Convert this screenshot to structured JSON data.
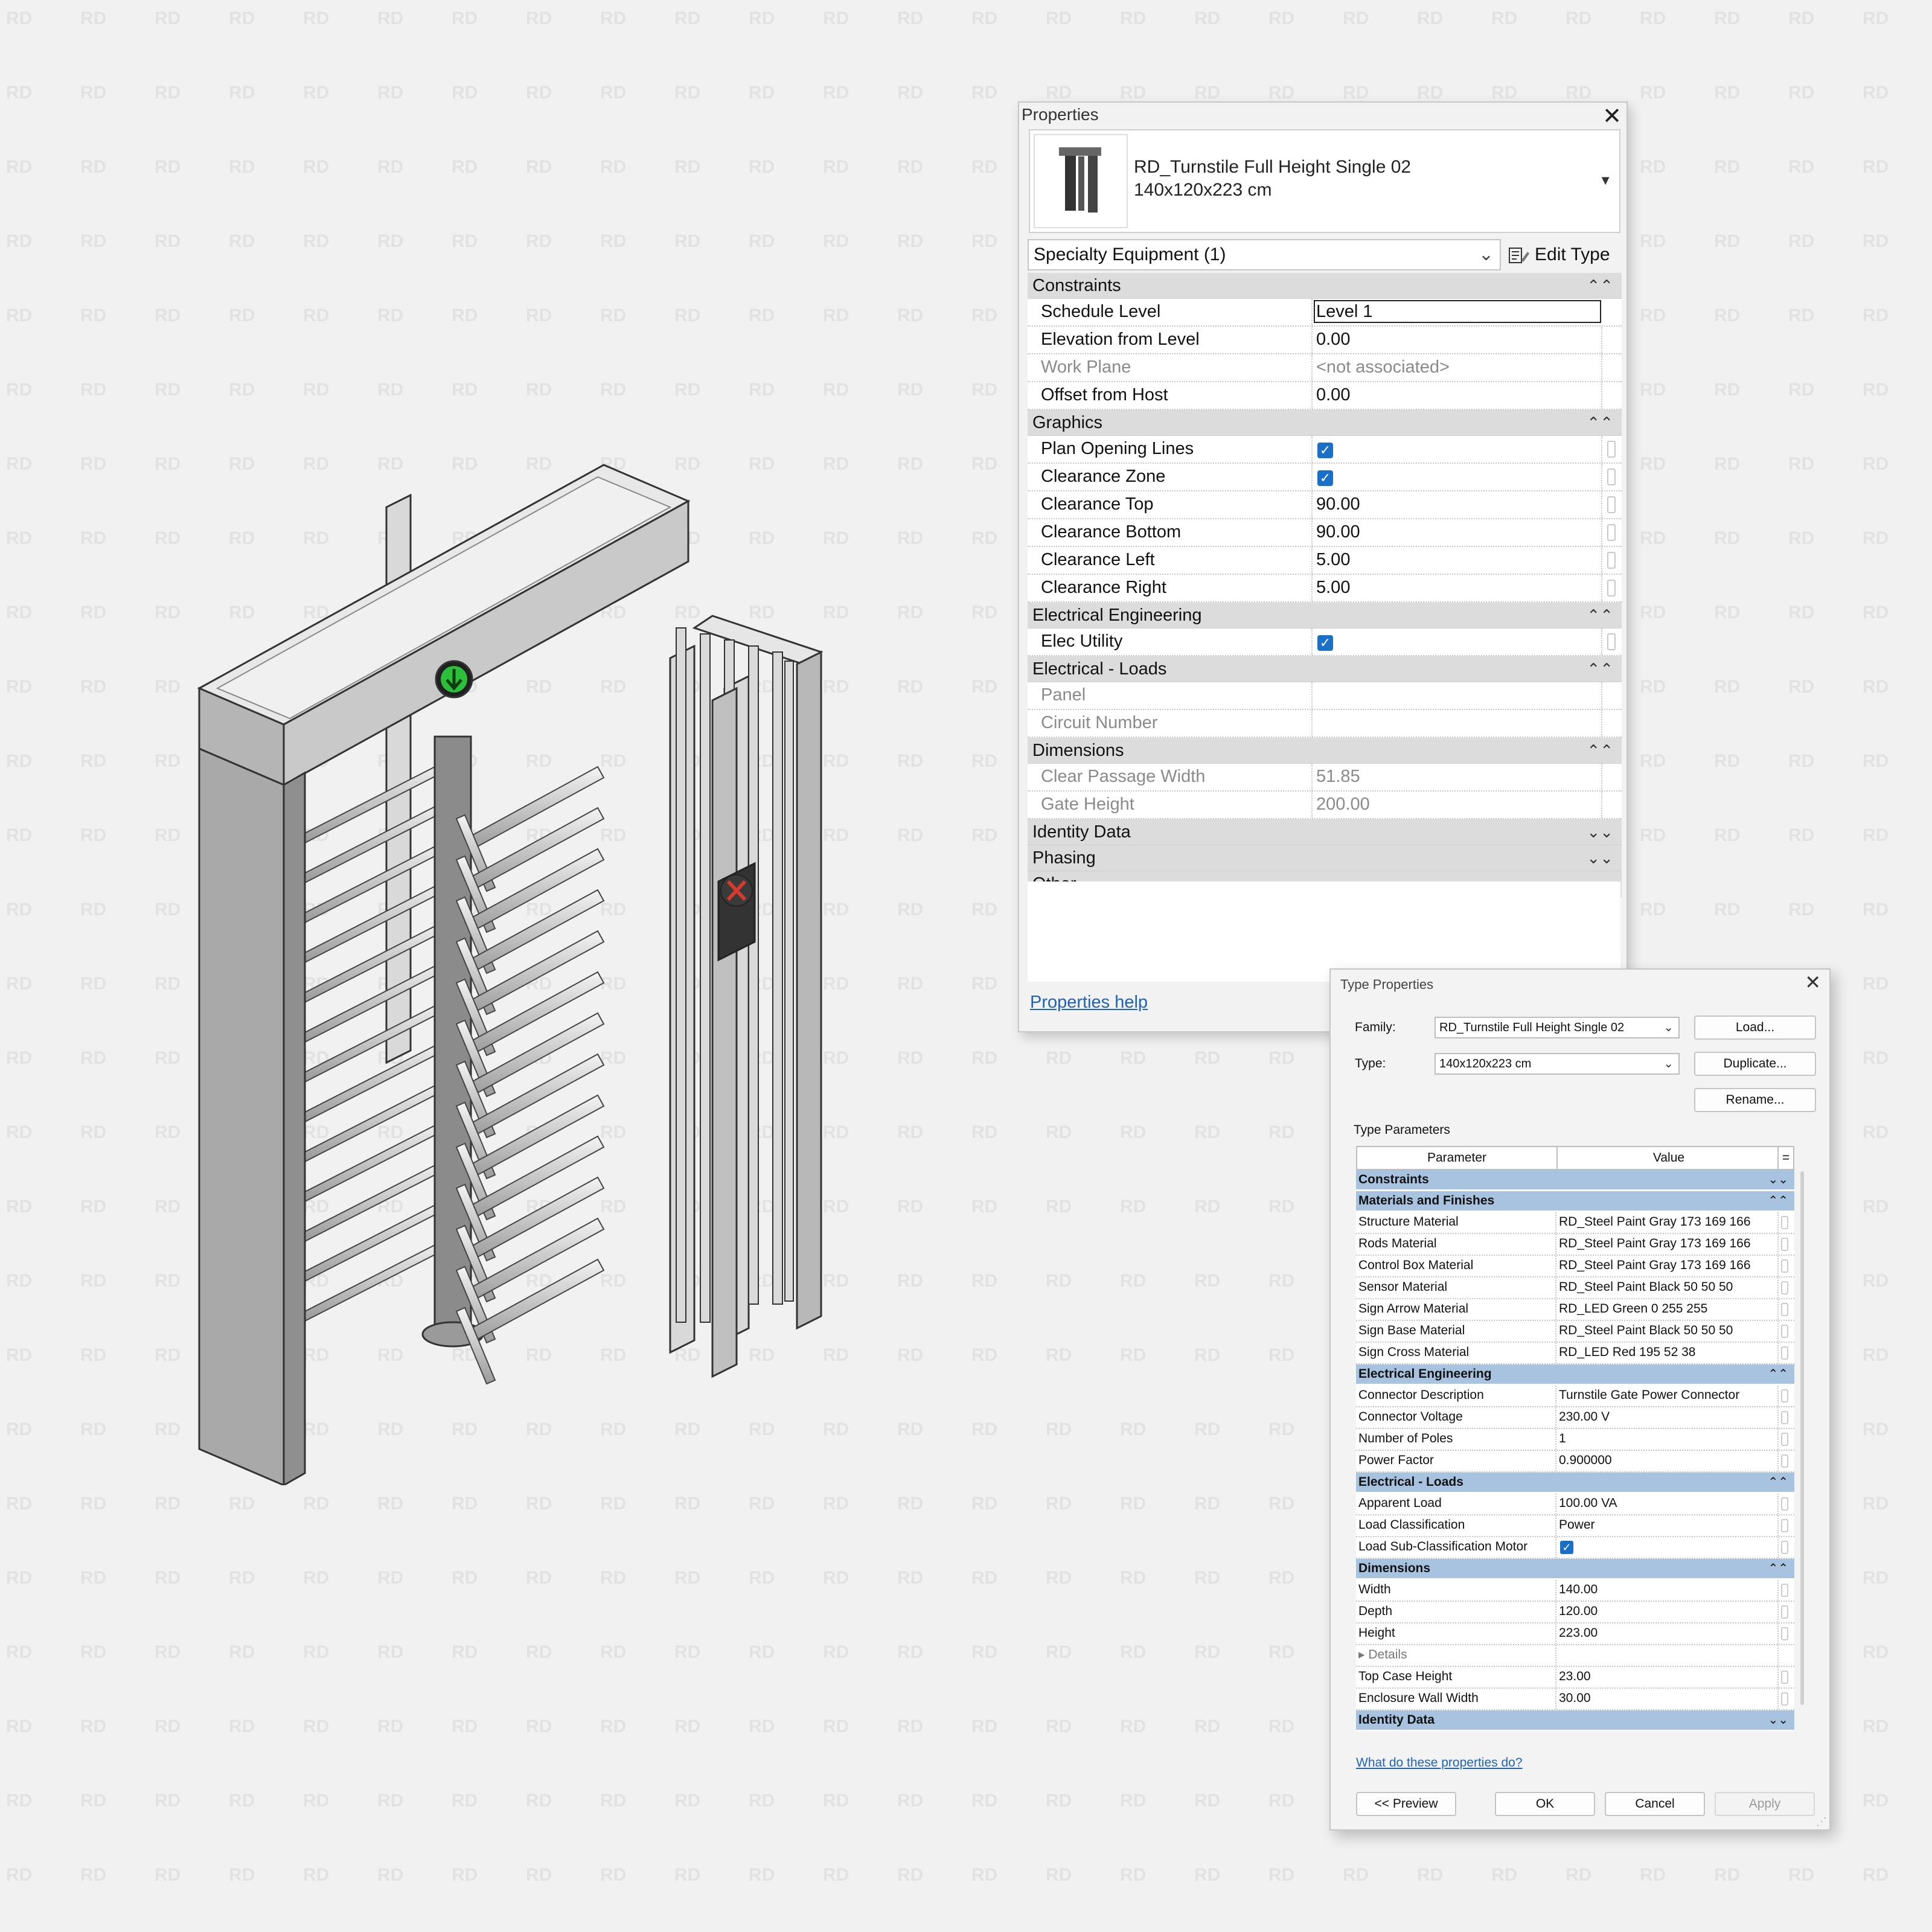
{
  "properties": {
    "title": "Properties",
    "close": "✕",
    "family_name": "RD_Turnstile Full Height Single 02",
    "type_name": "140x120x223 cm",
    "category_selector": "Specialty Equipment (1)",
    "edit_type": "Edit Type",
    "groups": {
      "constraints": "Constraints",
      "graphics": "Graphics",
      "elec_eng": "Electrical Engineering",
      "elec_loads": "Electrical - Loads",
      "dimensions": "Dimensions",
      "identity": "Identity Data",
      "phasing": "Phasing",
      "other": "Other"
    },
    "rows": {
      "schedule_level": {
        "name": "Schedule Level",
        "value": "Level 1"
      },
      "elevation": {
        "name": "Elevation from Level",
        "value": "0.00"
      },
      "work_plane": {
        "name": "Work Plane",
        "value": "<not associated>"
      },
      "offset_host": {
        "name": "Offset from Host",
        "value": "0.00"
      },
      "plan_opening": {
        "name": "Plan Opening Lines",
        "checked": true
      },
      "clearance_zone": {
        "name": "Clearance Zone",
        "checked": true
      },
      "clearance_top": {
        "name": "Clearance Top",
        "value": "90.00"
      },
      "clearance_bottom": {
        "name": "Clearance Bottom",
        "value": "90.00"
      },
      "clearance_left": {
        "name": "Clearance Left",
        "value": "5.00"
      },
      "clearance_right": {
        "name": "Clearance Right",
        "value": "5.00"
      },
      "elec_utility": {
        "name": "Elec Utility",
        "checked": true
      },
      "panel": {
        "name": "Panel",
        "value": ""
      },
      "circuit": {
        "name": "Circuit Number",
        "value": ""
      },
      "clear_passage": {
        "name": "Clear Passage Width",
        "value": "51.85"
      },
      "gate_height": {
        "name": "Gate Height",
        "value": "200.00"
      }
    },
    "help_link": "Properties help"
  },
  "type_properties": {
    "title": "Type Properties",
    "close": "✕",
    "family_label": "Family:",
    "family_value": "RD_Turnstile Full Height Single 02",
    "type_label": "Type:",
    "type_value": "140x120x223 cm",
    "load_btn": "Load...",
    "duplicate_btn": "Duplicate...",
    "rename_btn": "Rename...",
    "params_label": "Type Parameters",
    "col_param": "Parameter",
    "col_value": "Value",
    "col_eq": "=",
    "groups": {
      "constraints": "Constraints",
      "materials": "Materials and Finishes",
      "elec_eng": "Electrical Engineering",
      "elec_loads": "Electrical - Loads",
      "dimensions": "Dimensions",
      "identity": "Identity Data"
    },
    "rows": {
      "structure_material": {
        "name": "Structure Material",
        "value": "RD_Steel Paint Gray 173 169 166"
      },
      "rods_material": {
        "name": "Rods Material",
        "value": "RD_Steel Paint Gray 173 169 166"
      },
      "control_box_material": {
        "name": "Control Box Material",
        "value": "RD_Steel Paint Gray 173 169 166"
      },
      "sensor_material": {
        "name": "Sensor Material",
        "value": "RD_Steel Paint Black 50 50 50"
      },
      "sign_arrow_material": {
        "name": "Sign Arrow Material",
        "value": "RD_LED Green 0 255 255"
      },
      "sign_base_material": {
        "name": "Sign Base Material",
        "value": "RD_Steel Paint Black 50 50 50"
      },
      "sign_cross_material": {
        "name": "Sign Cross Material",
        "value": "RD_LED Red 195 52 38"
      },
      "connector_desc": {
        "name": "Connector Description",
        "value": "Turnstile Gate Power Connector"
      },
      "connector_voltage": {
        "name": "Connector Voltage",
        "value": "230.00 V"
      },
      "num_poles": {
        "name": "Number of Poles",
        "value": "1"
      },
      "power_factor": {
        "name": "Power Factor",
        "value": "0.900000"
      },
      "apparent_load": {
        "name": "Apparent Load",
        "value": "100.00 VA"
      },
      "load_class": {
        "name": "Load Classification",
        "value": "Power"
      },
      "load_subclass": {
        "name": "Load Sub-Classification Motor",
        "checked": true
      },
      "width": {
        "name": "Width",
        "value": "140.00"
      },
      "depth": {
        "name": "Depth",
        "value": "120.00"
      },
      "height": {
        "name": "Height",
        "value": "223.00"
      },
      "details": {
        "name": "▸ Details",
        "value": ""
      },
      "top_case_height": {
        "name": "Top Case Height",
        "value": "23.00"
      },
      "enclosure_wall_width": {
        "name": "Enclosure Wall Width",
        "value": "30.00"
      }
    },
    "help_link": "What do these properties do?",
    "preview_btn": "<< Preview",
    "ok_btn": "OK",
    "cancel_btn": "Cancel",
    "apply_btn": "Apply"
  },
  "watermark": "RD",
  "icons": {
    "group_expanded": "⌃⌃",
    "group_collapsed": "⌄⌄",
    "dropdown": "⌄"
  },
  "colors": {
    "link": "#1e63b8",
    "checkbox": "#1a6fc6",
    "group_header_type": "#a8c3e0",
    "sign_green": "#2bbf3a",
    "sign_red": "#d63a2c"
  }
}
